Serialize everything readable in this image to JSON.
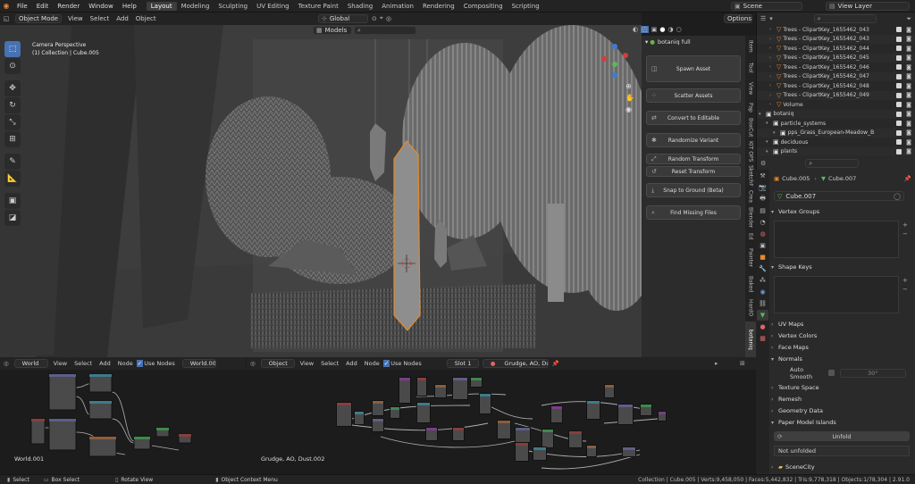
{
  "menu": [
    "File",
    "Edit",
    "Render",
    "Window",
    "Help"
  ],
  "workspaces": [
    "Layout",
    "Modeling",
    "Sculpting",
    "UV Editing",
    "Texture Paint",
    "Shading",
    "Animation",
    "Rendering",
    "Compositing",
    "Scripting"
  ],
  "active_workspace": "Layout",
  "scene": "Scene",
  "view_layer": "View Layer",
  "viewport": {
    "mode": "Object Mode",
    "menus": [
      "View",
      "Select",
      "Add",
      "Object"
    ],
    "orientation": "Global",
    "options": "Options",
    "collection_dropdown": "Models",
    "overlay_title": "Camera Perspective",
    "overlay_sub": "(1) Collection | Cube.005"
  },
  "botaniq": {
    "title": "botaniq full",
    "buttons": [
      "Spawn Asset",
      "Scatter Assets",
      "Convert to Editable",
      "Randomize Variant",
      "Random Transform",
      "Reset Transform",
      "Snap to Ground (Beta)",
      "Find Missing Files"
    ],
    "tabs": [
      "Item",
      "Tool",
      "View",
      "Pap",
      "BoxCut",
      "KIT OPS",
      "SketchF",
      "Crea",
      "Blender",
      "Ed",
      "Painter",
      "Baked",
      "HardO",
      "botaniq"
    ]
  },
  "outliner": {
    "rows": [
      {
        "name": "Trees - ClipartKey_1655462_043",
        "type": "mesh"
      },
      {
        "name": "Trees - ClipartKey_1655462_043",
        "type": "mesh"
      },
      {
        "name": "Trees - ClipartKey_1655462_044",
        "type": "mesh"
      },
      {
        "name": "Trees - ClipartKey_1655462_045",
        "type": "mesh"
      },
      {
        "name": "Trees - ClipartKey_1655462_046",
        "type": "mesh"
      },
      {
        "name": "Trees - ClipartKey_1655462_047",
        "type": "mesh"
      },
      {
        "name": "Trees - ClipartKey_1655462_048",
        "type": "mesh"
      },
      {
        "name": "Trees - ClipartKey_1655462_049",
        "type": "mesh"
      },
      {
        "name": "Volume",
        "type": "mesh"
      },
      {
        "name": "botaniq",
        "type": "collection"
      },
      {
        "name": "particle_systems",
        "type": "collection"
      },
      {
        "name": "pps_Grass_European-Meadow_B",
        "type": "collection"
      },
      {
        "name": "deciduous",
        "type": "collection"
      },
      {
        "name": "plants",
        "type": "collection"
      }
    ]
  },
  "properties": {
    "object": "Cube.005",
    "mesh": "Cube.007",
    "data_name": "Cube.007",
    "sections": {
      "vertex_groups": "Vertex Groups",
      "shape_keys": "Shape Keys",
      "uv_maps": "UV Maps",
      "vertex_colors": "Vertex Colors",
      "face_maps": "Face Maps",
      "normals": "Normals",
      "auto_smooth": "Auto Smooth",
      "auto_smooth_angle": "30°",
      "texture_space": "Texture Space",
      "remesh": "Remesh",
      "geometry_data": "Geometry Data",
      "paper_model": "Paper Model Islands",
      "unfold": "Unfold",
      "not_unfolded": "Not unfolded",
      "scenecity": "SceneCity"
    }
  },
  "node_left": {
    "type": "World",
    "menus": [
      "View",
      "Select",
      "Add",
      "Node"
    ],
    "use_nodes": "Use Nodes",
    "datablock": "World.001",
    "label": "World.001"
  },
  "node_right": {
    "type": "Object",
    "menus": [
      "View",
      "Select",
      "Add",
      "Node"
    ],
    "use_nodes": "Use Nodes",
    "slot": "Slot 1",
    "material": "Grudge, AO, Dust.002",
    "label": "Grudge, AO, Dust.002"
  },
  "status": {
    "select": "Select",
    "box_select": "Box Select",
    "rotate": "Rotate View",
    "context": "Object Context Menu",
    "stats": "Collection | Cube.005 | Verts:9,458,050 | Faces:5,442,832 | Tris:9,778,318 | Objects:1/78,304 | 2.91.0"
  },
  "colors": {
    "accent": "#4772b3",
    "select_orange": "#e58a2e",
    "botaniq_green": "#6fb04a"
  }
}
